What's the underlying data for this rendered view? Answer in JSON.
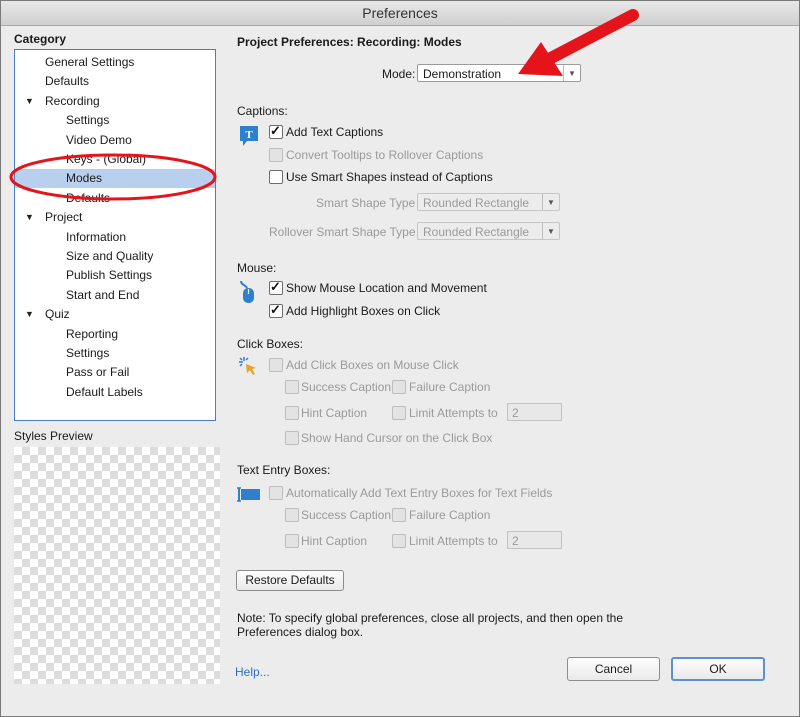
{
  "window": {
    "title": "Preferences"
  },
  "sidebar": {
    "category_label": "Category",
    "items": [
      {
        "label": "General Settings",
        "level": 1,
        "expander": false
      },
      {
        "label": "Defaults",
        "level": 1,
        "expander": false
      },
      {
        "label": "Recording",
        "level": 1,
        "expander": true
      },
      {
        "label": "Settings",
        "level": 2,
        "expander": false
      },
      {
        "label": "Video Demo",
        "level": 2,
        "expander": false
      },
      {
        "label": "Keys - (Global)",
        "level": 2,
        "expander": false
      },
      {
        "label": "Modes",
        "level": 2,
        "expander": false,
        "selected": true
      },
      {
        "label": "Defaults",
        "level": 2,
        "expander": false
      },
      {
        "label": "Project",
        "level": 1,
        "expander": true
      },
      {
        "label": "Information",
        "level": 2,
        "expander": false
      },
      {
        "label": "Size and Quality",
        "level": 2,
        "expander": false
      },
      {
        "label": "Publish Settings",
        "level": 2,
        "expander": false
      },
      {
        "label": "Start and End",
        "level": 2,
        "expander": false
      },
      {
        "label": "Quiz",
        "level": 1,
        "expander": true
      },
      {
        "label": "Reporting",
        "level": 2,
        "expander": false
      },
      {
        "label": "Settings",
        "level": 2,
        "expander": false
      },
      {
        "label": "Pass or Fail",
        "level": 2,
        "expander": false
      },
      {
        "label": "Default Labels",
        "level": 2,
        "expander": false
      }
    ],
    "expander_glyph": "▼",
    "styles_preview_label": "Styles Preview"
  },
  "main": {
    "heading": "Project Preferences: Recording: Modes",
    "mode_label": "Mode:",
    "mode_value": "Demonstration",
    "captions": {
      "title": "Captions:",
      "add_text_captions": "Add Text Captions",
      "convert_tooltips": "Convert Tooltips to Rollover Captions",
      "use_smart_shapes": "Use Smart Shapes instead of Captions",
      "smart_shape_type_label": "Smart Shape Type",
      "smart_shape_type_value": "Rounded Rectangle",
      "rollover_shape_type_label": "Rollover Smart Shape Type",
      "rollover_shape_type_value": "Rounded Rectangle"
    },
    "mouse": {
      "title": "Mouse:",
      "show_mouse": "Show Mouse Location and Movement",
      "add_highlight": "Add Highlight Boxes on Click"
    },
    "click_boxes": {
      "title": "Click Boxes:",
      "add_click_boxes": "Add Click Boxes on Mouse Click",
      "success_caption": "Success Caption",
      "failure_caption": "Failure Caption",
      "hint_caption": "Hint Caption",
      "limit_attempts": "Limit Attempts to",
      "limit_value": "2",
      "show_hand_cursor": "Show Hand Cursor on the Click Box"
    },
    "text_entry": {
      "title": "Text Entry Boxes:",
      "auto_add": "Automatically Add Text Entry Boxes for Text Fields",
      "success_caption": "Success Caption",
      "failure_caption": "Failure Caption",
      "hint_caption": "Hint Caption",
      "limit_attempts": "Limit Attempts to",
      "limit_value": "2"
    },
    "restore_defaults": "Restore Defaults",
    "note": "Note: To specify global preferences, close all projects, and then open the Preferences dialog box.",
    "help": "Help...",
    "cancel": "Cancel",
    "ok": "OK"
  },
  "colors": {
    "selection": "#b9cfee",
    "tree_border": "#4a7ec2",
    "annotation_red": "#e5141b",
    "icon_blue": "#2f7fcf"
  }
}
